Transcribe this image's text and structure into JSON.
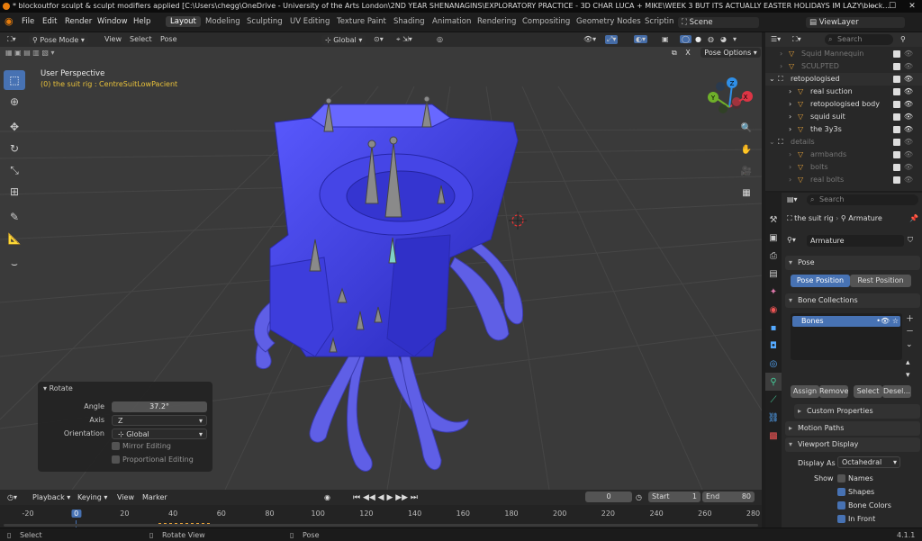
{
  "window": {
    "title": "* blockoutfor sculpt & sculpt modifiers applied [C:\\Users\\chegg\\OneDrive - University of the Arts London\\2ND YEAR SHENANAGINS\\EXPLORATORY PRACTICE - 3D CHAR LUCA + MIKE\\WEEK 3 BUT ITS ACTUALLY EASTER HOLIDAYS IM LAZY\\block...",
    "controls": [
      "—",
      "☐",
      "✕"
    ]
  },
  "menubar": {
    "menus": [
      "File",
      "Edit",
      "Render",
      "Window",
      "Help"
    ],
    "workspaces": [
      "Layout",
      "Modeling",
      "Sculpting",
      "UV Editing",
      "Texture Paint",
      "Shading",
      "Animation",
      "Rendering",
      "Compositing",
      "Geometry Nodes",
      "Scriptin"
    ],
    "active_workspace": "Layout",
    "scene": "Scene",
    "view_layer": "ViewLayer"
  },
  "viewport": {
    "mode": "Pose Mode",
    "menus": [
      "View",
      "Select",
      "Pose"
    ],
    "orientation": "Global",
    "pose_options": "Pose Options",
    "perspective_label": "User Perspective",
    "context_label": "(0) the suit rig : CentreSuitLowPacient",
    "axes": {
      "x": "X",
      "y": "Y",
      "z": "Z"
    },
    "mesh_color": "#3a3ad8"
  },
  "rotate_panel": {
    "title": "Rotate",
    "angle_label": "Angle",
    "angle_value": "37.2°",
    "axis_label": "Axis",
    "axis_value": "Z",
    "orientation_label": "Orientation",
    "orientation_value": "Global",
    "mirror_label": "Mirror Editing",
    "proportional_label": "Proportional Editing"
  },
  "outliner": {
    "search_placeholder": "Search",
    "rows": [
      {
        "label": "Squid Mannequin",
        "dim": true
      },
      {
        "label": "SCULPTED",
        "dim": true
      },
      {
        "label": "retopologised",
        "dim": false
      },
      {
        "label": "real suction",
        "dim": false
      },
      {
        "label": "retopologised body",
        "dim": false
      },
      {
        "label": "squid suit",
        "dim": false
      },
      {
        "label": "the 3y3s",
        "dim": false
      },
      {
        "label": "details",
        "dim": true
      },
      {
        "label": "armbands",
        "dim": true
      },
      {
        "label": "bolts",
        "dim": true
      },
      {
        "label": "real bolts",
        "dim": true
      }
    ]
  },
  "properties": {
    "search_placeholder": "Search",
    "breadcrumb_object": "the suit rig",
    "breadcrumb_data": "Armature",
    "data_name": "Armature",
    "pose_section": "Pose",
    "pose_position": "Pose Position",
    "rest_position": "Rest Position",
    "bone_collections": "Bone Collections",
    "bones_item": "Bones",
    "assign": "Assign",
    "remove": "Remove",
    "select": "Select",
    "deselect": "Desel...",
    "custom_properties": "Custom Properties",
    "motion_paths": "Motion Paths",
    "viewport_display": "Viewport Display",
    "display_as_label": "Display As",
    "display_as_value": "Octahedral",
    "show_label": "Show",
    "names": "Names",
    "shapes": "Shapes",
    "bone_colors": "Bone Colors",
    "in_front": "In Front"
  },
  "timeline": {
    "menus": [
      "Playback",
      "Keying",
      "View",
      "Marker"
    ],
    "current_frame": "0",
    "start_label": "Start",
    "start_value": "1",
    "end_label": "End",
    "end_value": "80",
    "ticks": [
      "-20",
      "0",
      "20",
      "40",
      "60",
      "80",
      "100",
      "120",
      "140",
      "160",
      "180",
      "200",
      "220",
      "240",
      "260",
      "280"
    ]
  },
  "statusbar": {
    "select": "Select",
    "rotate_view": "Rotate View",
    "pose": "Pose",
    "version": "4.1.1"
  }
}
